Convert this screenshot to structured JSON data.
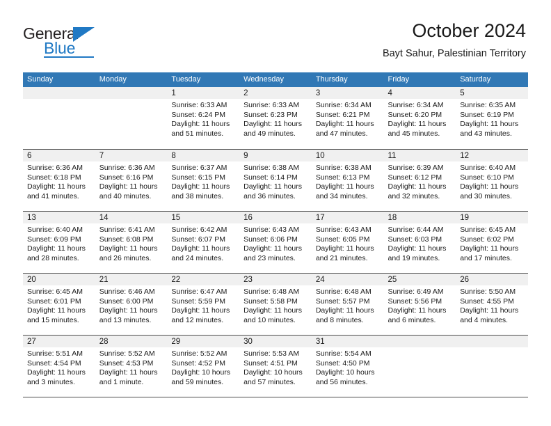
{
  "brand": {
    "name_top": "General",
    "name_bottom": "Blue",
    "accent_color": "#2079c4",
    "logo_icon": "blue-triangle"
  },
  "header": {
    "title": "October 2024",
    "subtitle": "Bayt Sahur, Palestinian Territory"
  },
  "calendar": {
    "header_bg": "#3178b5",
    "day_band_bg": "#f0f0f0",
    "weekday_headers": [
      "Sunday",
      "Monday",
      "Tuesday",
      "Wednesday",
      "Thursday",
      "Friday",
      "Saturday"
    ],
    "weeks": [
      [
        {
          "day": "",
          "sunrise": "",
          "sunset": "",
          "daylight": "",
          "empty": true
        },
        {
          "day": "",
          "sunrise": "",
          "sunset": "",
          "daylight": "",
          "empty": true
        },
        {
          "day": "1",
          "sunrise": "Sunrise: 6:33 AM",
          "sunset": "Sunset: 6:24 PM",
          "daylight": "Daylight: 11 hours and 51 minutes."
        },
        {
          "day": "2",
          "sunrise": "Sunrise: 6:33 AM",
          "sunset": "Sunset: 6:23 PM",
          "daylight": "Daylight: 11 hours and 49 minutes."
        },
        {
          "day": "3",
          "sunrise": "Sunrise: 6:34 AM",
          "sunset": "Sunset: 6:21 PM",
          "daylight": "Daylight: 11 hours and 47 minutes."
        },
        {
          "day": "4",
          "sunrise": "Sunrise: 6:34 AM",
          "sunset": "Sunset: 6:20 PM",
          "daylight": "Daylight: 11 hours and 45 minutes."
        },
        {
          "day": "5",
          "sunrise": "Sunrise: 6:35 AM",
          "sunset": "Sunset: 6:19 PM",
          "daylight": "Daylight: 11 hours and 43 minutes."
        }
      ],
      [
        {
          "day": "6",
          "sunrise": "Sunrise: 6:36 AM",
          "sunset": "Sunset: 6:18 PM",
          "daylight": "Daylight: 11 hours and 41 minutes."
        },
        {
          "day": "7",
          "sunrise": "Sunrise: 6:36 AM",
          "sunset": "Sunset: 6:16 PM",
          "daylight": "Daylight: 11 hours and 40 minutes."
        },
        {
          "day": "8",
          "sunrise": "Sunrise: 6:37 AM",
          "sunset": "Sunset: 6:15 PM",
          "daylight": "Daylight: 11 hours and 38 minutes."
        },
        {
          "day": "9",
          "sunrise": "Sunrise: 6:38 AM",
          "sunset": "Sunset: 6:14 PM",
          "daylight": "Daylight: 11 hours and 36 minutes."
        },
        {
          "day": "10",
          "sunrise": "Sunrise: 6:38 AM",
          "sunset": "Sunset: 6:13 PM",
          "daylight": "Daylight: 11 hours and 34 minutes."
        },
        {
          "day": "11",
          "sunrise": "Sunrise: 6:39 AM",
          "sunset": "Sunset: 6:12 PM",
          "daylight": "Daylight: 11 hours and 32 minutes."
        },
        {
          "day": "12",
          "sunrise": "Sunrise: 6:40 AM",
          "sunset": "Sunset: 6:10 PM",
          "daylight": "Daylight: 11 hours and 30 minutes."
        }
      ],
      [
        {
          "day": "13",
          "sunrise": "Sunrise: 6:40 AM",
          "sunset": "Sunset: 6:09 PM",
          "daylight": "Daylight: 11 hours and 28 minutes."
        },
        {
          "day": "14",
          "sunrise": "Sunrise: 6:41 AM",
          "sunset": "Sunset: 6:08 PM",
          "daylight": "Daylight: 11 hours and 26 minutes."
        },
        {
          "day": "15",
          "sunrise": "Sunrise: 6:42 AM",
          "sunset": "Sunset: 6:07 PM",
          "daylight": "Daylight: 11 hours and 24 minutes."
        },
        {
          "day": "16",
          "sunrise": "Sunrise: 6:43 AM",
          "sunset": "Sunset: 6:06 PM",
          "daylight": "Daylight: 11 hours and 23 minutes."
        },
        {
          "day": "17",
          "sunrise": "Sunrise: 6:43 AM",
          "sunset": "Sunset: 6:05 PM",
          "daylight": "Daylight: 11 hours and 21 minutes."
        },
        {
          "day": "18",
          "sunrise": "Sunrise: 6:44 AM",
          "sunset": "Sunset: 6:03 PM",
          "daylight": "Daylight: 11 hours and 19 minutes."
        },
        {
          "day": "19",
          "sunrise": "Sunrise: 6:45 AM",
          "sunset": "Sunset: 6:02 PM",
          "daylight": "Daylight: 11 hours and 17 minutes."
        }
      ],
      [
        {
          "day": "20",
          "sunrise": "Sunrise: 6:45 AM",
          "sunset": "Sunset: 6:01 PM",
          "daylight": "Daylight: 11 hours and 15 minutes."
        },
        {
          "day": "21",
          "sunrise": "Sunrise: 6:46 AM",
          "sunset": "Sunset: 6:00 PM",
          "daylight": "Daylight: 11 hours and 13 minutes."
        },
        {
          "day": "22",
          "sunrise": "Sunrise: 6:47 AM",
          "sunset": "Sunset: 5:59 PM",
          "daylight": "Daylight: 11 hours and 12 minutes."
        },
        {
          "day": "23",
          "sunrise": "Sunrise: 6:48 AM",
          "sunset": "Sunset: 5:58 PM",
          "daylight": "Daylight: 11 hours and 10 minutes."
        },
        {
          "day": "24",
          "sunrise": "Sunrise: 6:48 AM",
          "sunset": "Sunset: 5:57 PM",
          "daylight": "Daylight: 11 hours and 8 minutes."
        },
        {
          "day": "25",
          "sunrise": "Sunrise: 6:49 AM",
          "sunset": "Sunset: 5:56 PM",
          "daylight": "Daylight: 11 hours and 6 minutes."
        },
        {
          "day": "26",
          "sunrise": "Sunrise: 5:50 AM",
          "sunset": "Sunset: 4:55 PM",
          "daylight": "Daylight: 11 hours and 4 minutes."
        }
      ],
      [
        {
          "day": "27",
          "sunrise": "Sunrise: 5:51 AM",
          "sunset": "Sunset: 4:54 PM",
          "daylight": "Daylight: 11 hours and 3 minutes."
        },
        {
          "day": "28",
          "sunrise": "Sunrise: 5:52 AM",
          "sunset": "Sunset: 4:53 PM",
          "daylight": "Daylight: 11 hours and 1 minute."
        },
        {
          "day": "29",
          "sunrise": "Sunrise: 5:52 AM",
          "sunset": "Sunset: 4:52 PM",
          "daylight": "Daylight: 10 hours and 59 minutes."
        },
        {
          "day": "30",
          "sunrise": "Sunrise: 5:53 AM",
          "sunset": "Sunset: 4:51 PM",
          "daylight": "Daylight: 10 hours and 57 minutes."
        },
        {
          "day": "31",
          "sunrise": "Sunrise: 5:54 AM",
          "sunset": "Sunset: 4:50 PM",
          "daylight": "Daylight: 10 hours and 56 minutes."
        },
        {
          "day": "",
          "sunrise": "",
          "sunset": "",
          "daylight": "",
          "empty": true
        },
        {
          "day": "",
          "sunrise": "",
          "sunset": "",
          "daylight": "",
          "empty": true
        }
      ]
    ]
  }
}
